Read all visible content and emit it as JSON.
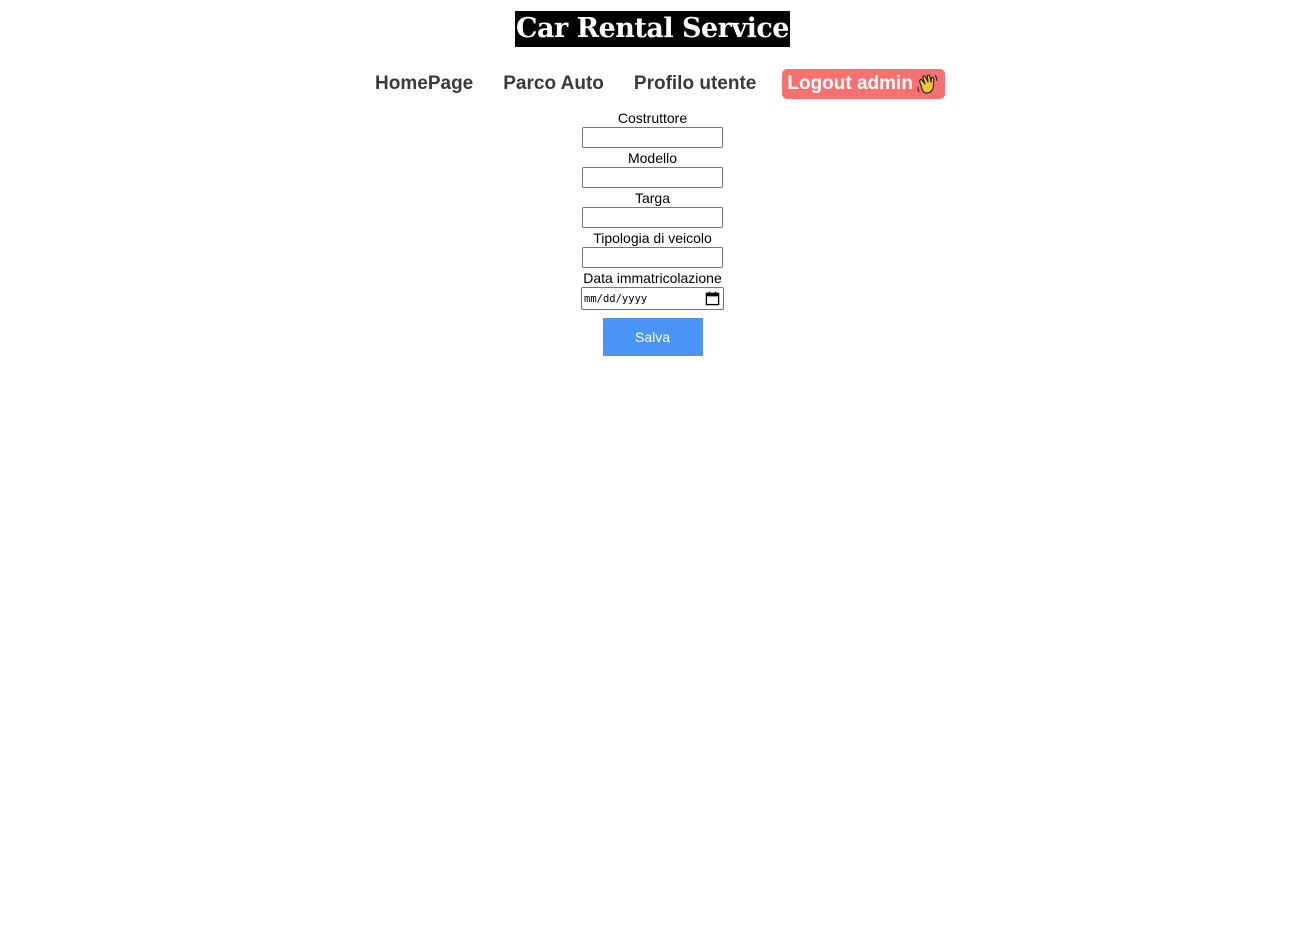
{
  "header": {
    "title": "Car Rental Service"
  },
  "nav": {
    "items": [
      {
        "label": "HomePage"
      },
      {
        "label": "Parco Auto"
      },
      {
        "label": "Profilo utente"
      }
    ],
    "logout": {
      "label": "Logout admin",
      "icon": "waving-hand-icon",
      "color": "#f87171"
    }
  },
  "form": {
    "fields": [
      {
        "label": "Costruttore",
        "value": ""
      },
      {
        "label": "Modello",
        "value": ""
      },
      {
        "label": "Targa",
        "value": ""
      },
      {
        "label": "Tipologia di veicolo",
        "value": ""
      }
    ],
    "date_field": {
      "label": "Data immatricolazione",
      "placeholder": "mm/dd/yyyy",
      "icon": "calendar-icon"
    },
    "submit": {
      "label": "Salva",
      "color": "#4a94f5"
    }
  }
}
